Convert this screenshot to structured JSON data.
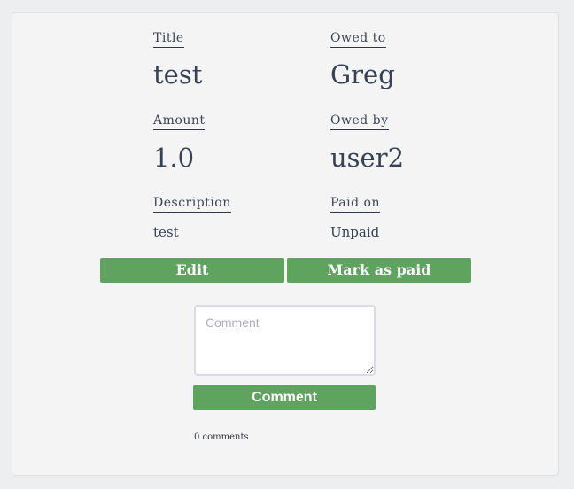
{
  "fields": {
    "title": {
      "label": "Title",
      "value": "test"
    },
    "owed_to": {
      "label": "Owed to",
      "value": "Greg"
    },
    "amount": {
      "label": "Amount",
      "value": "1.0"
    },
    "owed_by": {
      "label": "Owed by",
      "value": "user2"
    },
    "description": {
      "label": "Description",
      "value": "test"
    },
    "paid_on": {
      "label": "Paid on",
      "value": "Unpaid"
    }
  },
  "actions": {
    "edit_label": "Edit",
    "mark_paid_label": "Mark as paid"
  },
  "comment": {
    "placeholder": "Comment",
    "value": "",
    "submit_label": "Comment",
    "count_text": "0 comments"
  },
  "colors": {
    "button_green": "#5ea45f",
    "text_navy": "#354257",
    "page_background": "#eceeef",
    "card_background": "#f4f4f4"
  }
}
